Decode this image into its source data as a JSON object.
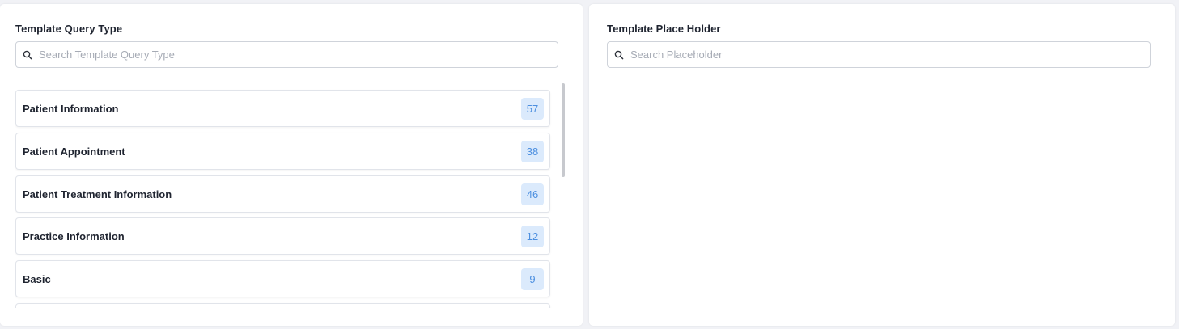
{
  "query_type_panel": {
    "title": "Template Query Type",
    "search": {
      "placeholder": "Search Template Query Type",
      "value": ""
    },
    "items": [
      {
        "label": "Patient Information",
        "count": "57"
      },
      {
        "label": "Patient Appointment",
        "count": "38"
      },
      {
        "label": "Patient Treatment Information",
        "count": "46"
      },
      {
        "label": "Practice Information",
        "count": "12"
      },
      {
        "label": "Basic",
        "count": "9"
      },
      {
        "label": "",
        "count": ""
      }
    ]
  },
  "placeholder_panel": {
    "title": "Template Place Holder",
    "search": {
      "placeholder": "Search Placeholder",
      "value": ""
    }
  },
  "colors": {
    "background": "#f1f2f6",
    "panel": "#ffffff",
    "badge_bg": "#dbeafc",
    "badge_text": "#4c8fe0",
    "border": "#e1e4ea"
  },
  "icons": {
    "search": "search-icon"
  }
}
